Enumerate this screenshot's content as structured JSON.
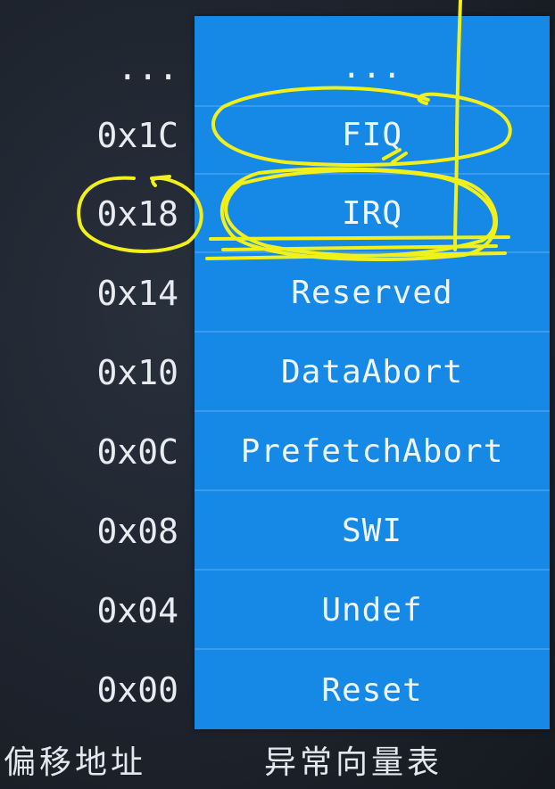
{
  "offsets": [
    "...",
    "0x1C",
    "0x18",
    "0x14",
    "0x10",
    "0x0C",
    "0x08",
    "0x04",
    "0x00"
  ],
  "vectors": [
    "...",
    "FIQ",
    "IRQ",
    "Reserved",
    "DataAbort",
    "PrefetchAbort",
    "SWI",
    "Undef",
    "Reset"
  ],
  "captions": {
    "offset_column": "偏移地址",
    "vector_column": "异常向量表"
  },
  "colors": {
    "table_fill": "#1688e6",
    "background": "#1e2530",
    "annotation": "#f2f01a"
  }
}
